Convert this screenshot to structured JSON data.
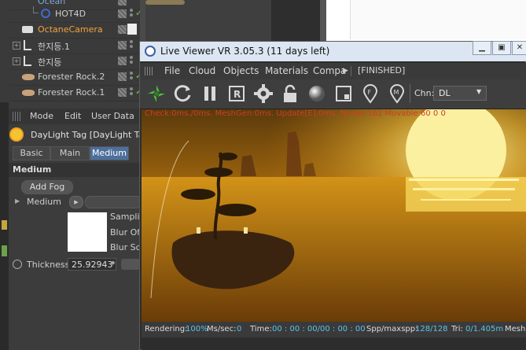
{
  "object_manager": {
    "rows": [
      {
        "label": "Ocean",
        "color": "#7fa8d8"
      },
      {
        "label": "HOT4D",
        "color": "#cfcfcf"
      },
      {
        "label": "OctaneCamera",
        "color": "#f2a33a"
      },
      {
        "label": "한지등.1",
        "color": "#cfcfcf"
      },
      {
        "label": "한지등",
        "color": "#cfcfcf"
      },
      {
        "label": "Forester Rock.2",
        "color": "#cfcfcf"
      },
      {
        "label": "Forester Rock.1",
        "color": "#cfcfcf"
      }
    ]
  },
  "attribute_manager": {
    "menu": [
      "Mode",
      "Edit",
      "User Data"
    ],
    "title": "DayLight Tag [DayLight Ta",
    "tabs": [
      "Basic",
      "Main",
      "Medium"
    ],
    "active_tab": "Medium",
    "section": "Medium",
    "add_fog_label": "Add Fog",
    "medium_label": "Medium",
    "side_labels": [
      "Sampli",
      "Blur Of",
      "Blur Sc"
    ],
    "thickness_label": "Thickness",
    "thickness_value": "25.92943"
  },
  "viewer": {
    "title": "Live Viewer VR 3.05.3 (11 days left)",
    "menu": [
      "File",
      "Cloud",
      "Objects",
      "Materials",
      "Compa"
    ],
    "status_flag": "[FINISHED]",
    "channel_label": "Chn:",
    "channel_value": "DL",
    "overlay_text": "Check:0ms./0ms. MeshGen:0ms. Update[E]:0ms. Nodes:162 Movable:60  0 0",
    "status": {
      "rendering_label": "Rendering:",
      "rendering_value": "100%",
      "ms_label": "Ms/sec:",
      "ms_value": "0",
      "time_label": "Time:",
      "time_value": "00 : 00 : 00/00 : 00 : 00",
      "spp_label": "Spp/maxspp:",
      "spp_value": "128/128",
      "tri_label": "Tri:",
      "tri_value": "0/1.405m",
      "mesh_label": "Mesh:"
    }
  },
  "colors": {
    "accent_blue": "#4d6f9c",
    "check_green": "#6fc24b",
    "status_value": "#5fc3e4",
    "overlay_red": "#c8402a"
  }
}
